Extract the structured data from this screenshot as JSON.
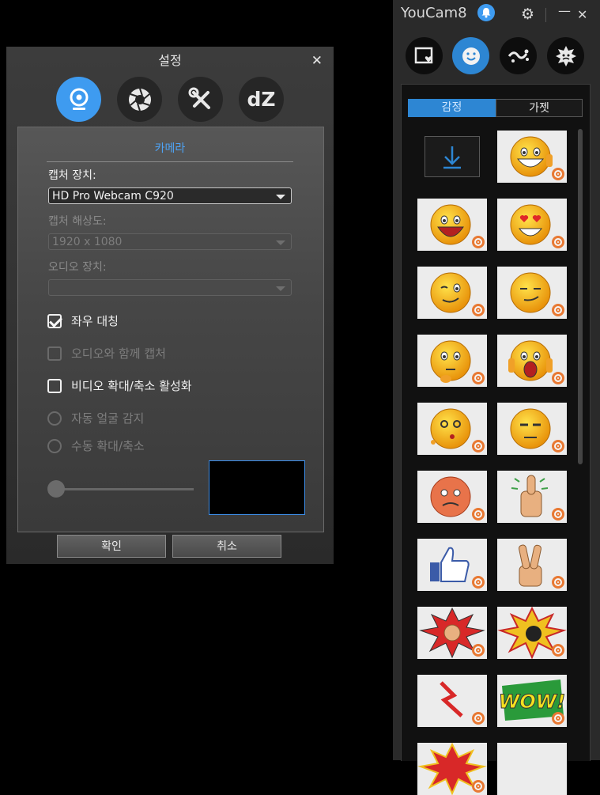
{
  "settings": {
    "title": "설정",
    "tabs": [
      {
        "name": "camera",
        "icon": "webcam-icon",
        "active": true
      },
      {
        "name": "capture",
        "icon": "shutter-icon",
        "active": false
      },
      {
        "name": "tools",
        "icon": "wrench-screwdriver-icon",
        "active": false
      },
      {
        "name": "dz",
        "icon": "dz-icon",
        "label": "dZ",
        "active": false
      }
    ],
    "section_title": "카메라",
    "capture_device_label": "캡처 장치:",
    "capture_device_value": "HD Pro Webcam C920",
    "resolution_label": "캡처 해상도:",
    "resolution_value": "1920 x 1080",
    "audio_device_label": "오디오 장치:",
    "audio_device_value": "",
    "mirror_label": "좌우 대칭",
    "mirror_checked": true,
    "capture_audio_label": "오디오와 함께 캡처",
    "capture_audio_checked": false,
    "zoom_enable_label": "비디오 확대/축소 활성화",
    "zoom_enable_checked": false,
    "auto_face_label": "자동 얼굴 감지",
    "manual_zoom_label": "수동 확대/축소",
    "zoom_level": 0,
    "ok_label": "확인",
    "cancel_label": "취소"
  },
  "youcam": {
    "title": "YouCam8",
    "modes": [
      {
        "name": "frame",
        "icon": "frame-heart-icon",
        "active": false
      },
      {
        "name": "emotion",
        "icon": "smiley-icon",
        "active": true
      },
      {
        "name": "particle",
        "icon": "particle-icon",
        "active": false
      },
      {
        "name": "distortion",
        "icon": "distortion-icon",
        "active": false
      }
    ],
    "segment_emotion": "감정",
    "segment_gadget": "가젯",
    "items": [
      {
        "name": "download",
        "icon": "download-icon"
      },
      {
        "name": "grin-thumbs-up",
        "icon": "grin-emoji-icon"
      },
      {
        "name": "laughing",
        "icon": "laugh-emoji-icon"
      },
      {
        "name": "heart-eyes",
        "icon": "heart-eyes-emoji-icon"
      },
      {
        "name": "wink",
        "icon": "wink-emoji-icon"
      },
      {
        "name": "smirk",
        "icon": "smirk-emoji-icon"
      },
      {
        "name": "thinking",
        "icon": "thinking-emoji-icon"
      },
      {
        "name": "scream",
        "icon": "scream-emoji-icon"
      },
      {
        "name": "dizzy",
        "icon": "dizzy-emoji-icon"
      },
      {
        "name": "unamused",
        "icon": "unamused-emoji-icon"
      },
      {
        "name": "angry-red",
        "icon": "angry-emoji-icon"
      },
      {
        "name": "thumbs-up-hand",
        "icon": "thumb-hand-icon"
      },
      {
        "name": "like",
        "icon": "like-icon"
      },
      {
        "name": "victory",
        "icon": "victory-hand-icon"
      },
      {
        "name": "punch-burst",
        "icon": "punch-burst-icon"
      },
      {
        "name": "bomb-burst",
        "icon": "bomb-burst-icon"
      },
      {
        "name": "lightning",
        "icon": "lightning-icon"
      },
      {
        "name": "wow-text",
        "icon": "wow-text-icon",
        "label": "WOW!"
      },
      {
        "name": "burst-partial",
        "icon": "burst-icon"
      },
      {
        "name": "blank-partial",
        "icon": "blank-icon"
      }
    ]
  }
}
